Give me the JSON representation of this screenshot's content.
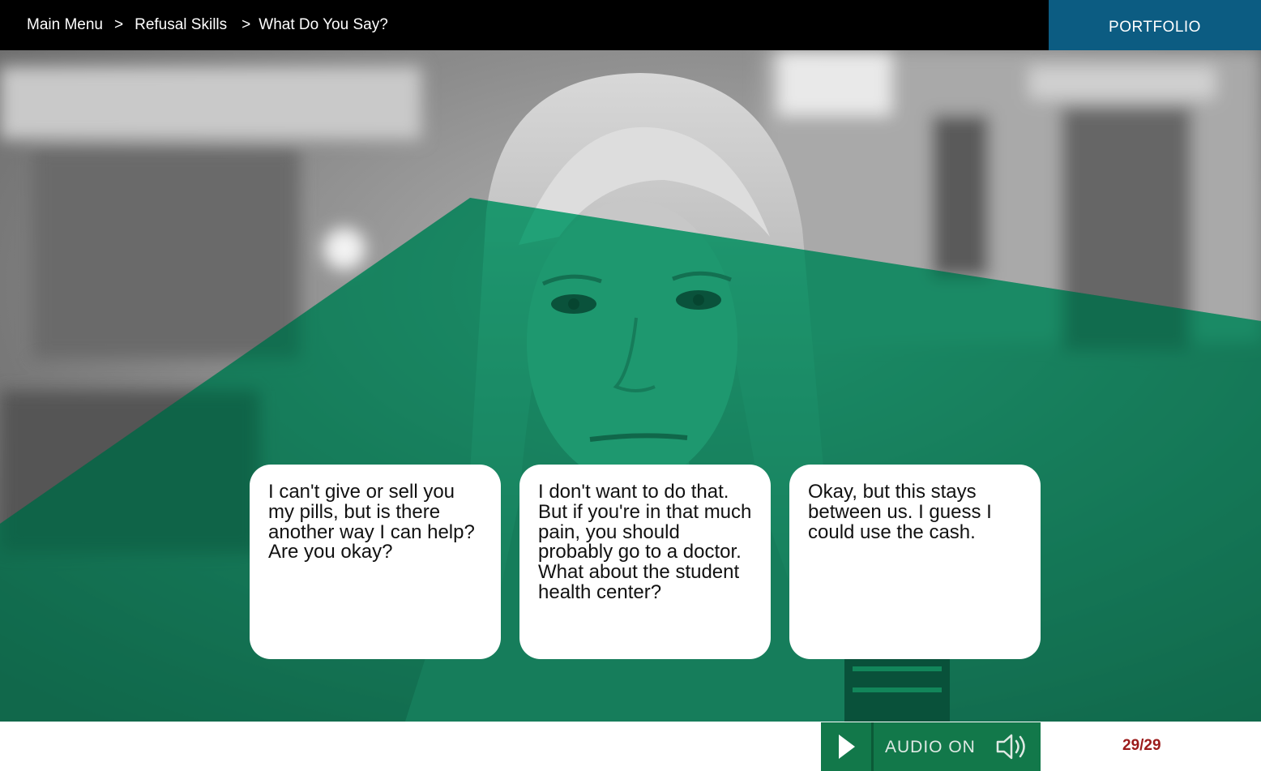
{
  "breadcrumb": {
    "items": [
      "Main Menu",
      "Refusal Skills",
      "What Do You Say?"
    ],
    "separator": ">"
  },
  "header": {
    "portfolio_label": "PORTFOLIO"
  },
  "colors": {
    "top_bar": "#000000",
    "portfolio_bg": "#0c5c82",
    "overlay_green": "#0a9a6a",
    "control_green": "#12784a",
    "page_counter": "#9b1b1b"
  },
  "options": [
    {
      "text": "I can't give or sell you my pills, but is there another way I can help? Are you okay?"
    },
    {
      "text": "I don't want to do that. But if you're in that much pain, you should probably go to a doctor. What about the student health center?"
    },
    {
      "text": "Okay, but this stays between us. I guess I could use the cash."
    }
  ],
  "controls": {
    "play_icon": "play-icon",
    "audio_label": "AUDIO ON",
    "audio_icon": "speaker-icon",
    "page_counter": "29/29"
  }
}
